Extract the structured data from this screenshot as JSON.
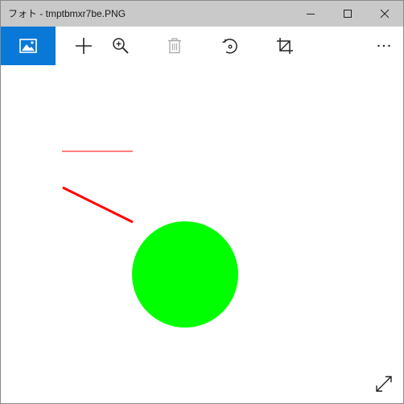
{
  "window": {
    "title": "フォト - tmptbmxr7be.PNG"
  },
  "titlebar_controls": [
    {
      "name": "minimize-button",
      "icon": "minimize-icon"
    },
    {
      "name": "maximize-button",
      "icon": "maximize-icon"
    },
    {
      "name": "close-button",
      "icon": "close-icon"
    }
  ],
  "toolbar": {
    "items": [
      {
        "name": "collection-button",
        "icon": "photo-icon"
      },
      {
        "name": "add-button",
        "icon": "plus-icon"
      },
      {
        "name": "zoom-button",
        "icon": "zoom-in-icon"
      },
      {
        "name": "delete-button",
        "icon": "trash-icon",
        "disabled": true
      },
      {
        "name": "rotate-button",
        "icon": "rotate-icon"
      },
      {
        "name": "crop-button",
        "icon": "crop-icon"
      },
      {
        "name": "more-button",
        "icon": "ellipsis-icon"
      }
    ],
    "accent": "#0a78d7"
  },
  "image_content": {
    "thin_line_color": "#ff0000",
    "thick_line_color": "#ff0000",
    "circle_color": "#00ff00"
  },
  "expand_control": {
    "icon": "expand-icon"
  }
}
